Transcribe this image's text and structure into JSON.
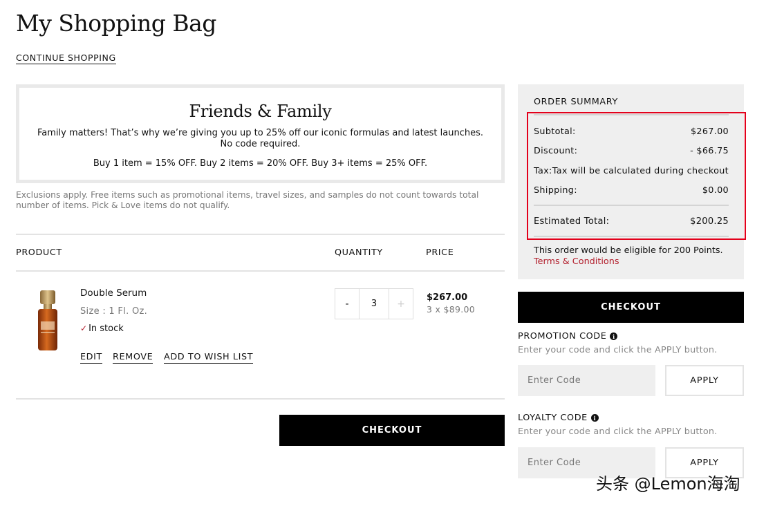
{
  "page": {
    "title": "My Shopping Bag",
    "continue_label": "CONTINUE SHOPPING"
  },
  "promo": {
    "title": "Friends & Family",
    "line1": "Family matters! That’s why we’re giving you up to 25% off our iconic formulas and latest launches.",
    "line2": "No code required.",
    "tiers": "Buy 1 item = 15% OFF. Buy 2 items = 20% OFF. Buy 3+ items = 25% OFF."
  },
  "exclusions": "Exclusions apply. Free items such as promotional items, travel sizes, and samples do not count towards total number of items. Pick & Love items do not qualify.",
  "table": {
    "col_product": "PRODUCT",
    "col_quantity": "QUANTITY",
    "col_price": "PRICE"
  },
  "item": {
    "name": "Double Serum",
    "size": "Size : 1 Fl. Oz.",
    "stock": "In stock",
    "qty_minus": "-",
    "qty": "3",
    "qty_plus": "+",
    "price": "$267.00",
    "unit_price": "3 x $89.00",
    "edit_label": "EDIT",
    "remove_label": "REMOVE",
    "wishlist_label": "ADD TO WISH LIST"
  },
  "checkout_label": "CHECKOUT",
  "summary": {
    "title": "ORDER SUMMARY",
    "subtotal_label": "Subtotal:",
    "subtotal": "$267.00",
    "discount_label": "Discount:",
    "discount": "- $66.75",
    "tax_label": "Tax:",
    "tax": "Tax will be calculated during checkout",
    "shipping_label": "Shipping:",
    "shipping": "$0.00",
    "total_label": "Estimated Total:",
    "total": "$200.25",
    "eligible": "This order would be eligible for 200 Points.",
    "terms": "Terms & Conditions"
  },
  "promo_code": {
    "label": "PROMOTION CODE",
    "hint": "Enter your code and click the APPLY button.",
    "placeholder": "Enter Code",
    "apply": "APPLY"
  },
  "loyalty_code": {
    "label": "LOYALTY CODE",
    "hint": "Enter your code and click the APPLY button.",
    "placeholder": "Enter Code",
    "apply": "APPLY"
  },
  "watermark": "头条 @Lemon海淘",
  "colors": {
    "accent_red": "#b21d2b",
    "highlight_red": "#e3001b",
    "button_black": "#000000",
    "panel_gray": "#efefef"
  }
}
